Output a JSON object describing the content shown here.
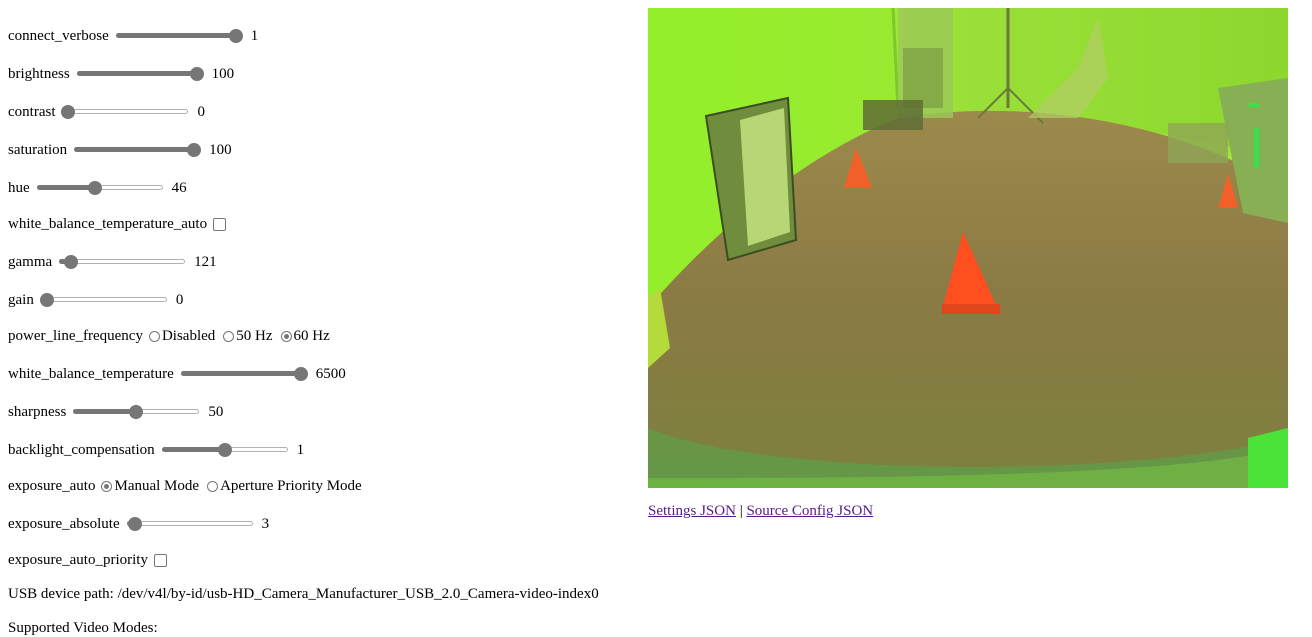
{
  "controls": {
    "connect_verbose": {
      "label": "connect_verbose",
      "value": "1",
      "min": 0,
      "max": 1,
      "level": 1
    },
    "brightness": {
      "label": "brightness",
      "value": "100",
      "min": 0,
      "max": 100,
      "level": 100
    },
    "contrast": {
      "label": "contrast",
      "value": "0",
      "min": 0,
      "max": 100,
      "level": 0
    },
    "saturation": {
      "label": "saturation",
      "value": "100",
      "min": 0,
      "max": 100,
      "level": 100
    },
    "hue": {
      "label": "hue",
      "value": "46",
      "min": 0,
      "max": 100,
      "level": 46
    },
    "white_balance_temperature_auto": {
      "label": "white_balance_temperature_auto"
    },
    "gamma": {
      "label": "gamma",
      "value": "121",
      "min": 100,
      "max": 500,
      "level": 121
    },
    "gain": {
      "label": "gain",
      "value": "0",
      "min": 0,
      "max": 100,
      "level": 0
    },
    "power_line_frequency": {
      "label": "power_line_frequency",
      "options": [
        "Disabled",
        "50 Hz",
        "60 Hz"
      ],
      "selected": "60 Hz"
    },
    "white_balance_temperature": {
      "label": "white_balance_temperature",
      "value": "6500",
      "min": 2800,
      "max": 6500,
      "level": 6500
    },
    "sharpness": {
      "label": "sharpness",
      "value": "50",
      "min": 0,
      "max": 100,
      "level": 50
    },
    "backlight_compensation": {
      "label": "backlight_compensation",
      "value": "1",
      "min": 0,
      "max": 2,
      "level": 1
    },
    "exposure_auto": {
      "label": "exposure_auto",
      "options": [
        "Manual Mode",
        "Aperture Priority Mode"
      ],
      "selected": "Manual Mode"
    },
    "exposure_absolute": {
      "label": "exposure_absolute",
      "value": "3",
      "min": 1,
      "max": 100,
      "level": 3
    },
    "exposure_auto_priority": {
      "label": "exposure_auto_priority"
    }
  },
  "usb_path": "USB device path: /dev/v4l/by-id/usb-HD_Camera_Manufacturer_USB_2.0_Camera-video-index0",
  "supported_modes": "Supported Video Modes:",
  "links": {
    "settings": "Settings JSON",
    "separator": "|",
    "source_config": "Source Config JSON"
  },
  "colors": {
    "slider": "#767676",
    "link_visited": "#551a8b",
    "camera_wall": "#8ee82a",
    "camera_floor": "#8c7a45",
    "cone": "#ff4a1e"
  }
}
